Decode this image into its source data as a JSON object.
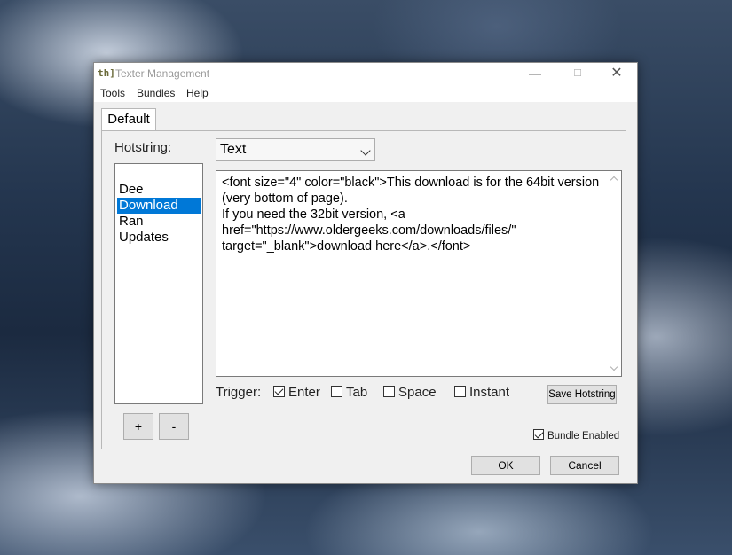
{
  "window": {
    "app_icon_text": "th]",
    "title": "Texter Management",
    "minimize_glyph": "—",
    "maximize_glyph": "☐",
    "close_glyph": "✕"
  },
  "menu": {
    "items": [
      "Tools",
      "Bundles",
      "Help"
    ]
  },
  "tabs": [
    {
      "label": "Default",
      "selected": true
    }
  ],
  "hotstring": {
    "label": "Hotstring:",
    "items": [
      {
        "label": "Dee",
        "selected": false
      },
      {
        "label": "Download",
        "selected": true
      },
      {
        "label": "Ran",
        "selected": false
      },
      {
        "label": "Updates",
        "selected": false
      }
    ],
    "add_label": "+",
    "remove_label": "-"
  },
  "type_select": {
    "value": "Text"
  },
  "content": {
    "text": "<font size=\"4\" color=\"black\">This download is for the 64bit version (very bottom of page).\nIf you need the 32bit version, <a href=\"https://www.oldergeeks.com/downloads/files/\" target=\"_blank\">download here</a>.</font>"
  },
  "trigger": {
    "label": "Trigger:",
    "options": [
      {
        "label": "Enter",
        "checked": true
      },
      {
        "label": "Tab",
        "checked": false
      },
      {
        "label": "Space",
        "checked": false
      },
      {
        "label": "Instant",
        "checked": false
      }
    ]
  },
  "save_button_label": "Save Hotstring",
  "bundle_enabled": {
    "label": "Bundle Enabled",
    "checked": true
  },
  "footer": {
    "ok_label": "OK",
    "cancel_label": "Cancel"
  }
}
